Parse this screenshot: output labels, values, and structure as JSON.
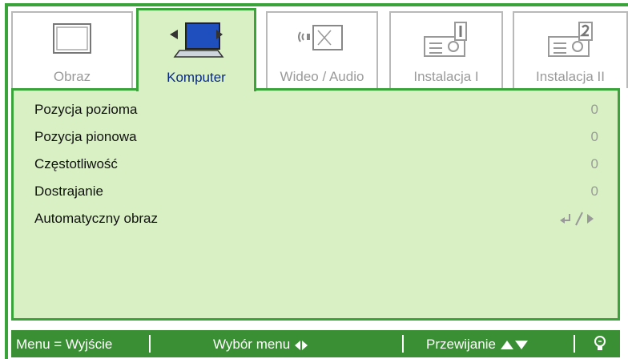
{
  "tabs": [
    {
      "label": "Obraz",
      "icon": "monitor-icon"
    },
    {
      "label": "Komputer",
      "icon": "computer-icon"
    },
    {
      "label": "Wideo / Audio",
      "icon": "video-audio-icon"
    },
    {
      "label": "Instalacja I",
      "icon": "projector-1-icon"
    },
    {
      "label": "Instalacja II",
      "icon": "projector-2-icon"
    }
  ],
  "active_tab": "Komputer",
  "rows": [
    {
      "name": "Pozycja pozioma",
      "value": "0"
    },
    {
      "name": "Pozycja pionowa",
      "value": "0"
    },
    {
      "name": "Częstotliwość",
      "value": "0"
    },
    {
      "name": "Dostrajanie",
      "value": "0"
    },
    {
      "name": "Automatyczny obraz",
      "value": "",
      "icon": "enter-arrow-icon"
    }
  ],
  "status": {
    "menu_exit": "Menu = Wyjście",
    "select_menu": "Wybór menu",
    "scroll": "Przewijanie",
    "bulb_icon": "bulb-icon"
  },
  "colors": {
    "accent_green": "#3aa43a",
    "panel_bg": "#d8f0c4",
    "status_bg": "#3a8e33",
    "active_label": "#0a2a8a"
  }
}
